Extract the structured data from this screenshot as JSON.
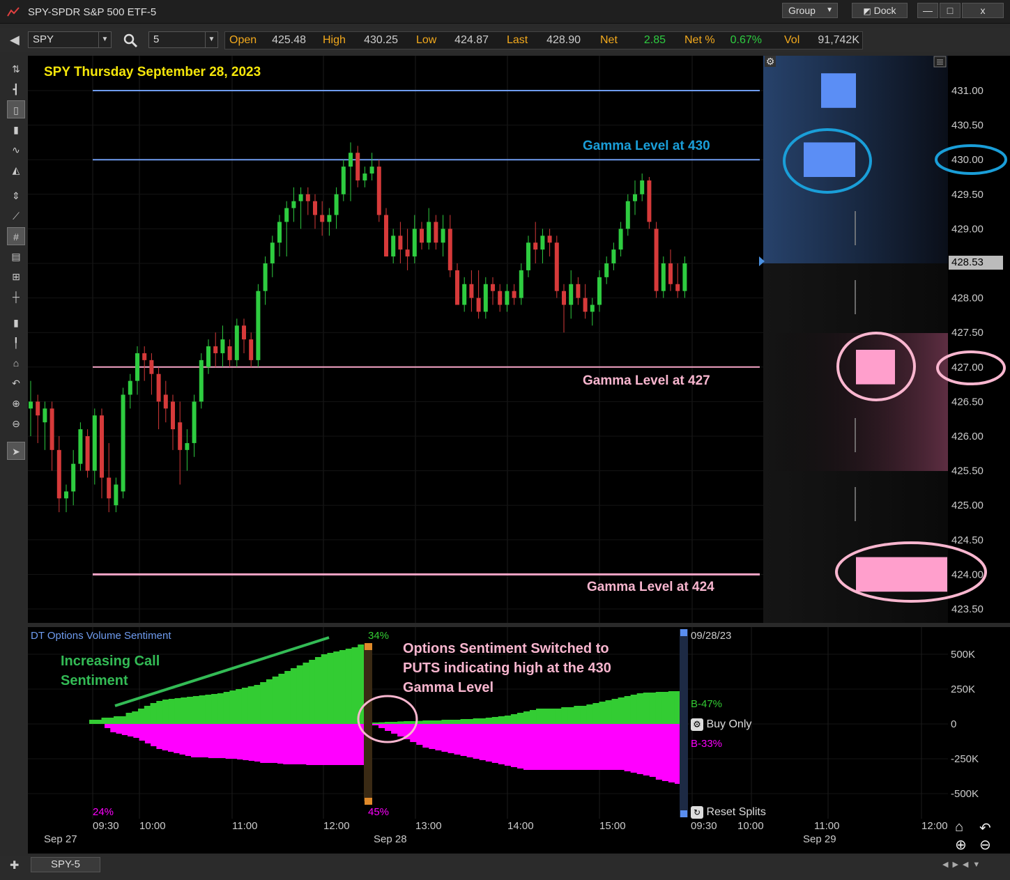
{
  "window": {
    "title": "SPY-SPDR S&P 500 ETF-5",
    "group_label": "Group",
    "dock_label": "Dock",
    "minimize_glyph": "—",
    "maximize_glyph": "□",
    "close_glyph": "x"
  },
  "toolbar": {
    "symbol": "SPY",
    "interval": "5",
    "quote": {
      "open_label": "Open",
      "open": "425.48",
      "high_label": "High",
      "high": "430.25",
      "low_label": "Low",
      "low": "424.87",
      "last_label": "Last",
      "last": "428.90",
      "net_label": "Net",
      "net": "2.85",
      "netpct_label": "Net %",
      "netpct": "0.67%",
      "vol_label": "Vol",
      "vol": "91,742K"
    }
  },
  "colors": {
    "background": "#000000",
    "up_candle": "#2ecc40",
    "down_candle": "#d63a3a",
    "gamma_blue": "#6f9cf0",
    "gamma_pink": "#f7a6c8",
    "annotation_blue": "#1a9ed8",
    "annotation_pink": "#f9b6cf",
    "title_yellow": "#f5e60a",
    "call_green": "#33cc33",
    "put_magenta": "#ff00ff",
    "axis_text": "#cccccc"
  },
  "chart_data": {
    "type": "candlestick",
    "title": "SPY Thursday September 28, 2023",
    "ylim": [
      423.25,
      431.75
    ],
    "y_ticks": [
      "431.00",
      "430.50",
      "430.00",
      "429.50",
      "429.00",
      "428.50",
      "428.00",
      "427.50",
      "427.00",
      "426.50",
      "426.00",
      "425.50",
      "425.00",
      "424.50",
      "424.00",
      "423.50"
    ],
    "current_price_label": "428.53",
    "current_price": 428.53,
    "gamma_levels": [
      {
        "price": 431.0,
        "label": "",
        "color": "blue"
      },
      {
        "price": 430.0,
        "label": "Gamma Level at 430",
        "color": "blue"
      },
      {
        "price": 427.0,
        "label": "Gamma Level at 427",
        "color": "pink"
      },
      {
        "price": 424.0,
        "label": "Gamma Level at 424",
        "color": "pink"
      }
    ],
    "candles": [
      [
        426.4,
        426.8,
        426.0,
        426.5
      ],
      [
        426.5,
        426.6,
        425.9,
        426.3
      ],
      [
        426.2,
        426.5,
        425.8,
        426.4
      ],
      [
        426.4,
        426.5,
        425.5,
        425.8
      ],
      [
        425.8,
        426.0,
        424.9,
        425.1
      ],
      [
        425.1,
        425.3,
        424.9,
        425.2
      ],
      [
        425.2,
        425.8,
        425.0,
        425.6
      ],
      [
        425.6,
        426.2,
        425.5,
        426.1
      ],
      [
        426.0,
        426.1,
        425.4,
        425.5
      ],
      [
        425.5,
        426.4,
        425.3,
        426.3
      ],
      [
        426.3,
        426.4,
        425.1,
        425.4
      ],
      [
        425.4,
        425.9,
        424.9,
        425.1
      ],
      [
        425.0,
        425.4,
        424.9,
        425.3
      ],
      [
        425.2,
        426.7,
        425.1,
        426.6
      ],
      [
        426.6,
        426.9,
        426.4,
        426.8
      ],
      [
        426.8,
        427.3,
        426.6,
        427.2
      ],
      [
        427.2,
        427.3,
        426.8,
        427.1
      ],
      [
        427.1,
        427.2,
        426.6,
        426.9
      ],
      [
        426.9,
        427.0,
        426.1,
        426.5
      ],
      [
        426.6,
        426.8,
        426.2,
        426.4
      ],
      [
        426.5,
        426.6,
        425.8,
        426.1
      ],
      [
        426.2,
        426.5,
        425.3,
        425.8
      ],
      [
        425.8,
        426.1,
        425.5,
        425.9
      ],
      [
        425.9,
        426.6,
        425.7,
        426.5
      ],
      [
        426.5,
        427.2,
        426.4,
        427.1
      ],
      [
        427.0,
        427.4,
        426.9,
        427.3
      ],
      [
        427.3,
        427.5,
        427.0,
        427.2
      ],
      [
        427.2,
        427.6,
        427.0,
        427.4
      ],
      [
        427.3,
        427.4,
        427.0,
        427.1
      ],
      [
        427.1,
        427.7,
        427.0,
        427.6
      ],
      [
        427.6,
        427.7,
        427.2,
        427.4
      ],
      [
        427.4,
        427.5,
        427.0,
        427.1
      ],
      [
        427.1,
        428.2,
        427.0,
        428.1
      ],
      [
        428.1,
        428.6,
        427.9,
        428.5
      ],
      [
        428.5,
        428.9,
        428.3,
        428.8
      ],
      [
        428.8,
        429.2,
        428.6,
        429.1
      ],
      [
        429.1,
        429.4,
        428.6,
        429.3
      ],
      [
        429.3,
        429.6,
        429.1,
        429.4
      ],
      [
        429.4,
        429.6,
        429.0,
        429.5
      ],
      [
        429.5,
        429.6,
        429.2,
        429.4
      ],
      [
        429.4,
        429.5,
        429.0,
        429.2
      ],
      [
        429.2,
        429.4,
        428.9,
        429.1
      ],
      [
        429.1,
        429.3,
        428.9,
        429.2
      ],
      [
        429.2,
        429.6,
        429.0,
        429.5
      ],
      [
        429.5,
        430.0,
        429.4,
        429.9
      ],
      [
        429.9,
        430.25,
        429.4,
        430.1
      ],
      [
        430.1,
        430.2,
        429.6,
        429.7
      ],
      [
        429.7,
        429.9,
        429.6,
        429.8
      ],
      [
        429.8,
        430.1,
        429.7,
        429.9
      ],
      [
        429.9,
        430.0,
        429.1,
        429.2
      ],
      [
        429.2,
        429.3,
        428.6,
        428.6
      ],
      [
        428.6,
        429.0,
        428.5,
        428.9
      ],
      [
        428.9,
        429.1,
        428.5,
        428.7
      ],
      [
        428.7,
        429.0,
        428.4,
        428.6
      ],
      [
        428.6,
        429.2,
        428.5,
        429.0
      ],
      [
        429.0,
        429.1,
        428.7,
        428.8
      ],
      [
        428.8,
        429.3,
        428.7,
        429.1
      ],
      [
        429.1,
        429.2,
        428.7,
        428.8
      ],
      [
        428.8,
        429.2,
        428.6,
        429.0
      ],
      [
        429.0,
        429.2,
        428.3,
        428.4
      ],
      [
        428.4,
        428.5,
        427.9,
        427.9
      ],
      [
        427.9,
        428.3,
        427.8,
        428.2
      ],
      [
        428.2,
        428.4,
        427.8,
        428.0
      ],
      [
        428.0,
        428.4,
        427.7,
        427.8
      ],
      [
        427.8,
        428.3,
        427.7,
        428.2
      ],
      [
        428.2,
        428.3,
        427.9,
        428.1
      ],
      [
        428.1,
        428.2,
        427.8,
        427.9
      ],
      [
        427.9,
        428.2,
        427.8,
        428.1
      ],
      [
        428.1,
        428.2,
        427.9,
        428.0
      ],
      [
        428.0,
        428.5,
        427.9,
        428.4
      ],
      [
        428.4,
        428.9,
        428.3,
        428.8
      ],
      [
        428.8,
        429.1,
        428.5,
        428.7
      ],
      [
        428.7,
        429.0,
        428.5,
        428.9
      ],
      [
        428.9,
        429.0,
        428.6,
        428.8
      ],
      [
        428.8,
        428.9,
        428.0,
        428.1
      ],
      [
        428.1,
        428.2,
        427.5,
        427.9
      ],
      [
        427.9,
        428.4,
        427.7,
        428.2
      ],
      [
        428.2,
        428.3,
        427.9,
        428.0
      ],
      [
        428.0,
        428.2,
        427.7,
        427.8
      ],
      [
        427.8,
        428.0,
        427.6,
        427.9
      ],
      [
        427.9,
        428.4,
        427.8,
        428.3
      ],
      [
        428.3,
        428.6,
        428.2,
        428.5
      ],
      [
        428.5,
        428.8,
        428.4,
        428.7
      ],
      [
        428.7,
        429.1,
        428.6,
        429.0
      ],
      [
        429.0,
        429.5,
        428.9,
        429.4
      ],
      [
        429.4,
        429.7,
        429.2,
        429.5
      ],
      [
        429.5,
        429.8,
        429.4,
        429.7
      ],
      [
        429.7,
        429.75,
        429.0,
        429.1
      ],
      [
        429.0,
        429.1,
        428.0,
        428.1
      ],
      [
        428.1,
        428.6,
        428.0,
        428.5
      ],
      [
        428.5,
        428.7,
        428.1,
        428.2
      ],
      [
        428.2,
        428.5,
        428.0,
        428.1
      ],
      [
        428.1,
        428.6,
        428.0,
        428.5
      ]
    ],
    "right_panel_blocks": [
      {
        "price_low": 430.75,
        "price_high": 431.25,
        "color": "blue",
        "size": "small"
      },
      {
        "price_low": 429.75,
        "price_high": 430.25,
        "color": "blue",
        "size": "medium"
      },
      {
        "price_low": 426.75,
        "price_high": 427.25,
        "color": "pink",
        "size": "small"
      },
      {
        "price_low": 423.75,
        "price_high": 424.25,
        "color": "pink",
        "size": "large"
      }
    ],
    "x_ticks": [
      "09:30",
      "10:00",
      "11:00",
      "12:00",
      "13:00",
      "14:00",
      "15:00",
      "09:30",
      "10:00",
      "11:00",
      "12:00"
    ],
    "date_labels": [
      "Sep 27",
      "Sep 28",
      "Sep 29"
    ]
  },
  "sentiment": {
    "title": "DT Options Volume Sentiment",
    "y_ticks": [
      "500K",
      "250K",
      "0",
      "-250K",
      "-500K"
    ],
    "buy_label": "B-47%",
    "sell_label": "B-33%",
    "buy_only": "Buy Only",
    "reset_splits": "Reset Splits",
    "date_marker": "09/28/23",
    "pct_top": "34%",
    "pct_bottom": "45%",
    "pct_left": "24%",
    "calls": [
      30,
      30,
      45,
      45,
      55,
      55,
      80,
      90,
      110,
      130,
      150,
      165,
      175,
      180,
      185,
      190,
      195,
      200,
      205,
      210,
      215,
      220,
      230,
      240,
      250,
      260,
      270,
      280,
      300,
      320,
      340,
      360,
      380,
      400,
      420,
      440,
      460,
      480,
      500,
      510,
      520,
      530,
      540,
      550,
      570
    ],
    "puts": [
      -30,
      -60,
      -70,
      -80,
      -90,
      -100,
      -120,
      -140,
      -160,
      -180,
      -190,
      -200,
      -210,
      -220,
      -230,
      -240,
      -240,
      -240,
      -245,
      -245,
      -245,
      -250,
      -250,
      -255,
      -260,
      -265,
      -270,
      -280,
      -280,
      -280,
      -285,
      -290,
      -290,
      -290,
      -290,
      -295,
      -295,
      -295,
      -295,
      -295,
      -295,
      -295,
      -295,
      -295,
      -295
    ],
    "calls2": [
      10,
      12,
      15,
      15,
      18,
      20,
      20,
      22,
      25,
      25,
      25,
      30,
      30,
      30,
      35,
      35,
      40,
      40,
      45,
      50,
      55,
      60,
      70,
      80,
      90,
      100,
      110,
      110,
      110,
      110,
      120,
      120,
      130,
      130,
      140,
      150,
      160,
      170,
      180,
      190,
      200,
      210,
      220,
      225,
      225,
      230,
      230,
      235,
      235,
      240
    ],
    "puts2": [
      -10,
      -30,
      -50,
      -70,
      -90,
      -110,
      -130,
      -150,
      -170,
      -180,
      -190,
      -200,
      -210,
      -220,
      -230,
      -240,
      -250,
      -260,
      -270,
      -280,
      -290,
      -300,
      -310,
      -320,
      -330,
      -330,
      -330,
      -330,
      -330,
      -330,
      -330,
      -330,
      -330,
      -330,
      -330,
      -330,
      -330,
      -330,
      -330,
      -330,
      -340,
      -350,
      -360,
      -370,
      -380,
      -400,
      -410,
      -420,
      -430,
      -430
    ]
  },
  "annotations": {
    "increasing_call": [
      "Increasing Call",
      "Sentiment"
    ],
    "switched": [
      "Options Sentiment Switched to",
      "PUTS indicating high at the 430",
      "Gamma Level"
    ]
  },
  "footer": {
    "tab_label": "SPY-5"
  }
}
